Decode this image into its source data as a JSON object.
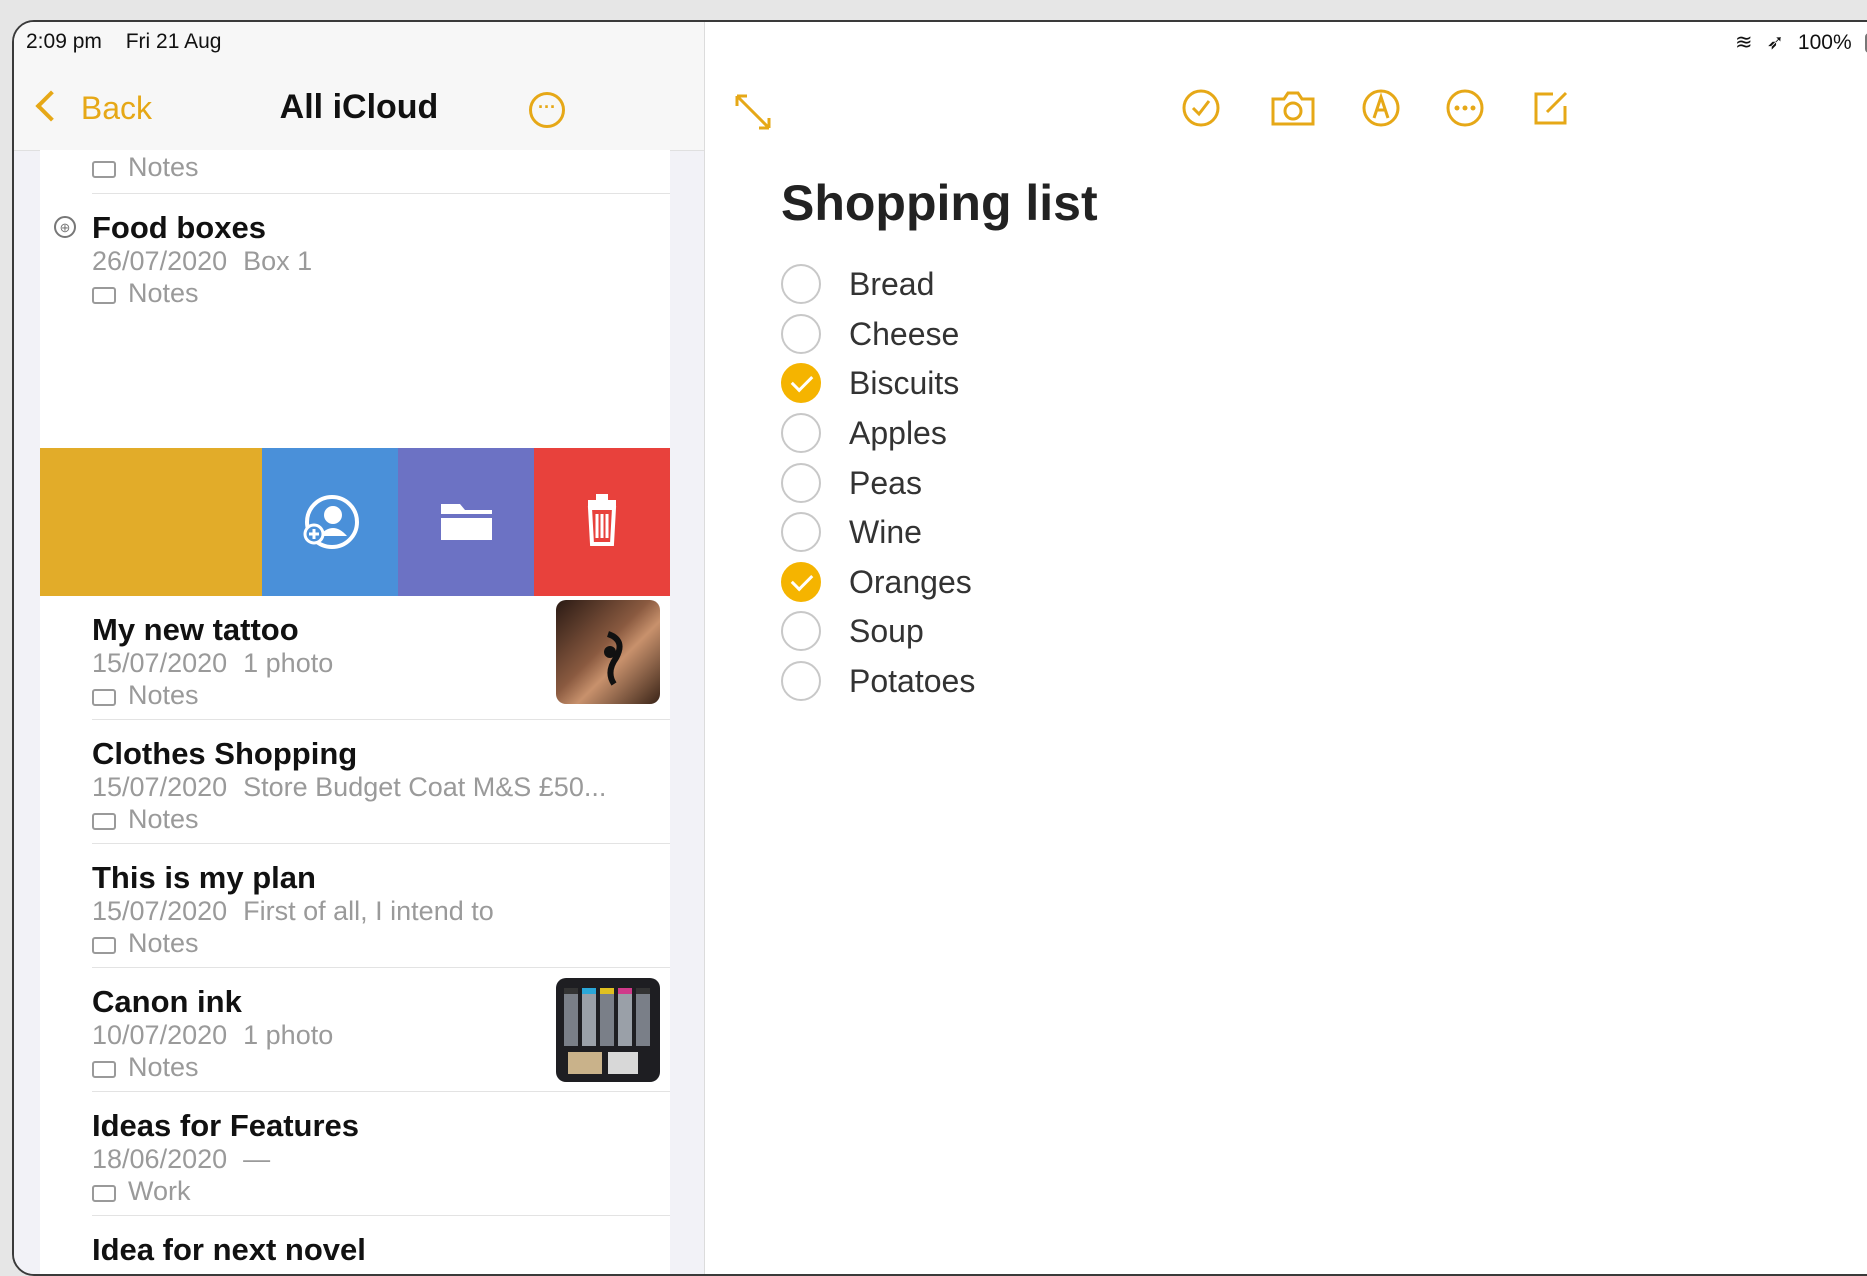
{
  "status": {
    "time": "2:09 pm",
    "date": "Fri 21 Aug",
    "battery": "100%"
  },
  "sidebar": {
    "back_label": "Back",
    "title": "All iCloud",
    "notes": [
      {
        "title": "",
        "date": "",
        "preview": "",
        "folder": "Notes"
      },
      {
        "title": "Food boxes",
        "date": "26/07/2020",
        "preview": "Box 1",
        "folder": "Notes"
      },
      {
        "title": "My new tattoo",
        "date": "15/07/2020",
        "preview": "1 photo",
        "folder": "Notes"
      },
      {
        "title": "Clothes Shopping",
        "date": "15/07/2020",
        "preview": "Store Budget Coat M&S £50...",
        "folder": "Notes"
      },
      {
        "title": "This is my plan",
        "date": "15/07/2020",
        "preview": "First of all, I intend to",
        "folder": "Notes"
      },
      {
        "title": "Canon ink",
        "date": "10/07/2020",
        "preview": "1 photo",
        "folder": "Notes"
      },
      {
        "title": "Ideas for Features",
        "date": "18/06/2020",
        "preview": "—",
        "folder": "Work"
      },
      {
        "title": "Idea for next novel",
        "date": "",
        "preview": "",
        "folder": ""
      }
    ],
    "swipe_actions": [
      "share-user-icon",
      "folder-icon",
      "trash-icon"
    ]
  },
  "toolbar": {
    "icons": [
      "expand-icon",
      "checklist-icon",
      "camera-icon",
      "markup-icon",
      "more-icon",
      "compose-icon"
    ]
  },
  "note": {
    "title": "Shopping list",
    "items": [
      {
        "label": "Bread",
        "checked": false
      },
      {
        "label": "Cheese",
        "checked": false
      },
      {
        "label": "Biscuits",
        "checked": true
      },
      {
        "label": "Apples",
        "checked": false
      },
      {
        "label": "Peas",
        "checked": false
      },
      {
        "label": "Wine",
        "checked": false
      },
      {
        "label": "Oranges",
        "checked": true
      },
      {
        "label": "Soup",
        "checked": false
      },
      {
        "label": "Potatoes",
        "checked": false
      }
    ]
  },
  "colors": {
    "accent": "#e6a817",
    "swipe_yellow": "#e2ac29",
    "swipe_blue": "#4a90d9",
    "swipe_purple": "#6c72c4",
    "swipe_red": "#e8413c"
  }
}
